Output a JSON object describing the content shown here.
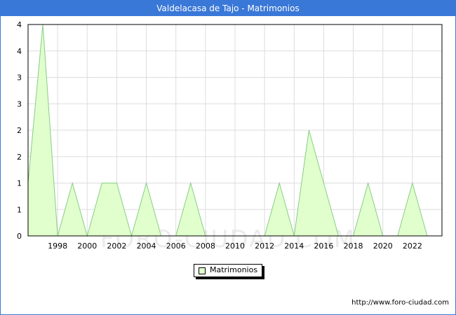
{
  "header": {
    "title": "Valdelacasa de Tajo - Matrimonios"
  },
  "footer": {
    "url": "http://www.foro-ciudad.com"
  },
  "watermark": {
    "text": "FORO-CIUDAD.COM"
  },
  "legend": {
    "label": "Matrimonios",
    "position": "bottom-center"
  },
  "colors": {
    "header_bg": "#3a78d8",
    "area_fill": "#e0ffcc",
    "area_line": "#88cc88",
    "grid": "#dddddd"
  },
  "chart_data": {
    "type": "area",
    "x": [
      1996,
      1997,
      1998,
      1999,
      2000,
      2001,
      2002,
      2003,
      2004,
      2005,
      2006,
      2007,
      2008,
      2009,
      2010,
      2011,
      2012,
      2013,
      2014,
      2015,
      2016,
      2017,
      2018,
      2019,
      2020,
      2021,
      2022,
      2023
    ],
    "series": [
      {
        "name": "Matrimonios",
        "values": [
          1,
          4,
          0,
          1,
          0,
          1,
          1,
          0,
          1,
          0,
          0,
          1,
          0,
          0,
          0,
          0,
          0,
          1,
          0,
          2,
          1,
          0,
          0,
          1,
          0,
          0,
          1,
          0
        ]
      }
    ],
    "xticks": [
      "1998",
      "2000",
      "2002",
      "2004",
      "2006",
      "2008",
      "2010",
      "2012",
      "2014",
      "2016",
      "2018",
      "2020",
      "2022"
    ],
    "yticks": [
      "0",
      "1",
      "1",
      "2",
      "2",
      "3",
      "3",
      "4",
      "4"
    ],
    "xlim": [
      1996,
      2024
    ],
    "ylim": [
      0,
      4
    ],
    "grid": true
  }
}
